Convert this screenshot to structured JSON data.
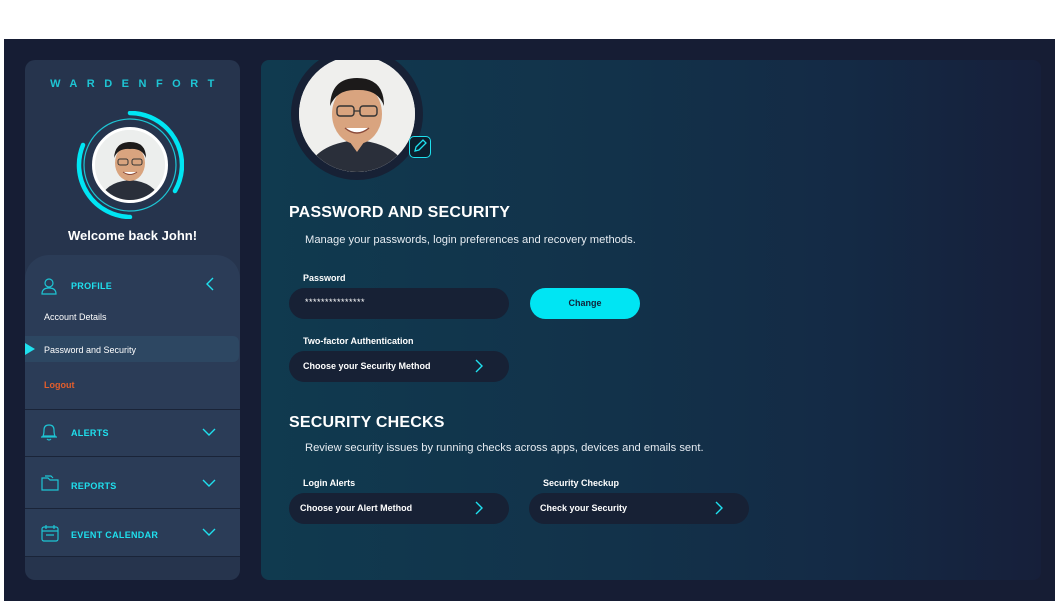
{
  "sidebar": {
    "brand": "WARDENFORT",
    "welcome": "Welcome back John!",
    "profile": {
      "label": "PROFILE",
      "items": [
        "Account Details",
        "Password and Security"
      ],
      "logout": "Logout"
    },
    "nav": [
      {
        "label": "ALERTS",
        "icon": "bell-icon"
      },
      {
        "label": "REPORTS",
        "icon": "folder-icon"
      },
      {
        "label": "EVENT CALENDAR",
        "icon": "calendar-icon"
      }
    ]
  },
  "main": {
    "password_section": {
      "title": "PASSWORD AND SECURITY",
      "subtitle": "Manage your passwords, login preferences and recovery methods.",
      "password_label": "Password",
      "password_value": "***************",
      "change_button": "Change",
      "twofa_label": "Two-factor Authentication",
      "twofa_button": "Choose your Security Method"
    },
    "checks_section": {
      "title": "SECURITY CHECKS",
      "subtitle": "Review security issues by running checks across apps, devices and emails sent.",
      "login_alerts_label": "Login Alerts",
      "login_alerts_button": "Choose your Alert Method",
      "checkup_label": "Security Checkup",
      "checkup_button": "Check your Security"
    }
  },
  "colors": {
    "accent": "#1fe0ee",
    "logout": "#e35e2c",
    "background": "#161d34",
    "sidebar": "#26344d"
  }
}
